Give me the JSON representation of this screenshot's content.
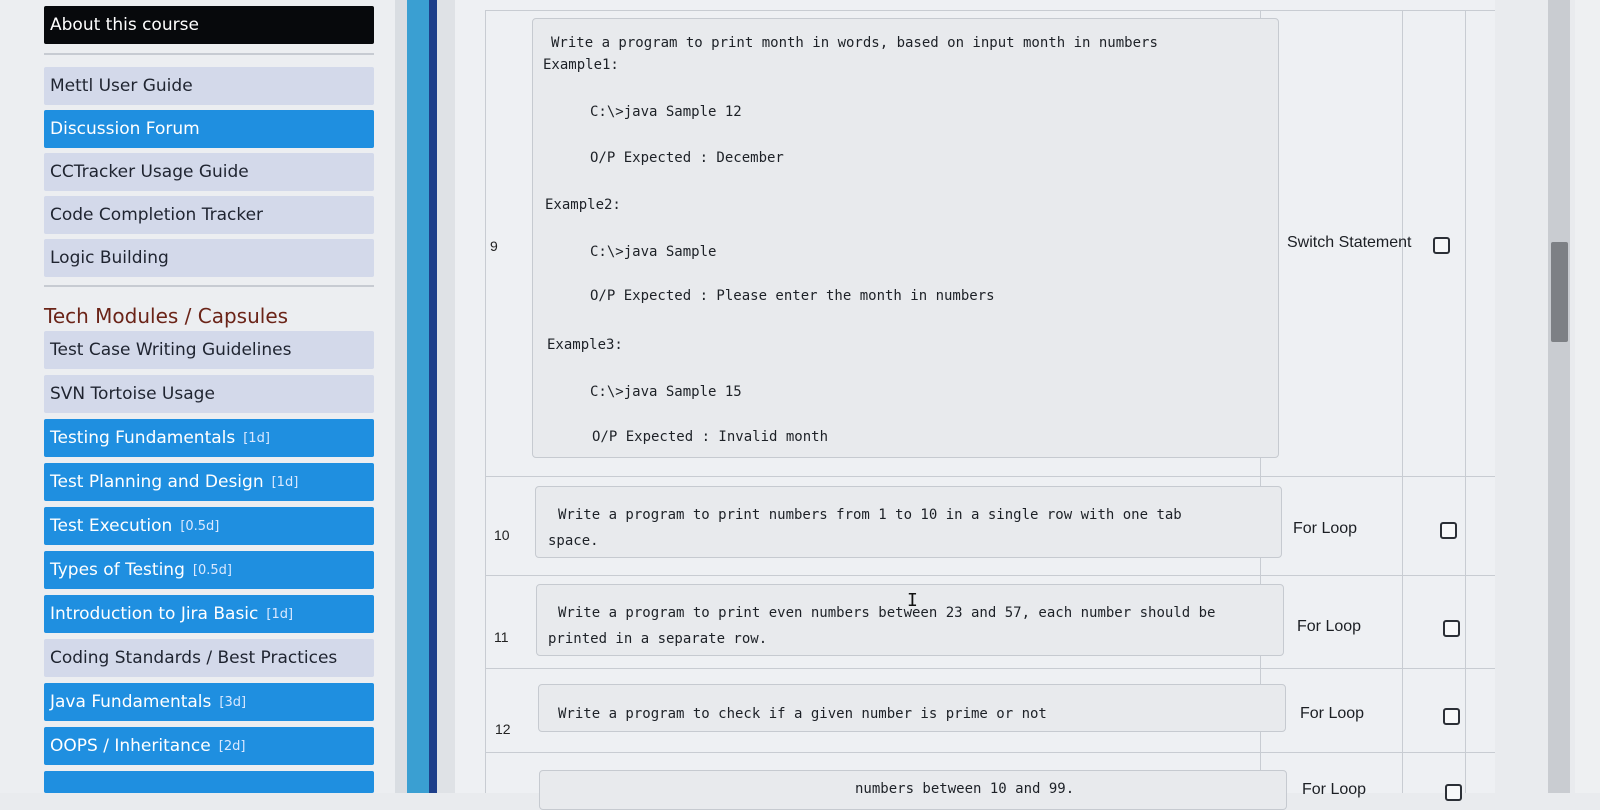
{
  "sidebar": {
    "about": "About this course",
    "items_top": [
      {
        "label": "Mettl User Guide",
        "style": "light"
      },
      {
        "label": "Discussion Forum",
        "style": "blue"
      },
      {
        "label": "CCTracker Usage Guide",
        "style": "light"
      },
      {
        "label": "Code Completion Tracker",
        "style": "light"
      },
      {
        "label": "Logic Building",
        "style": "light"
      }
    ],
    "section_heading": "Tech Modules / Capsules",
    "modules": [
      {
        "label": "Test Case Writing Guidelines",
        "duration": "",
        "style": "light"
      },
      {
        "label": "SVN Tortoise Usage",
        "duration": "",
        "style": "light"
      },
      {
        "label": "Testing Fundamentals",
        "duration": "[1d]",
        "style": "blue"
      },
      {
        "label": "Test Planning and Design",
        "duration": "[1d]",
        "style": "blue"
      },
      {
        "label": "Test Execution",
        "duration": "[0.5d]",
        "style": "blue"
      },
      {
        "label": "Types of Testing",
        "duration": "[0.5d]",
        "style": "blue"
      },
      {
        "label": "Introduction to Jira Basic",
        "duration": "[1d]",
        "style": "blue"
      },
      {
        "label": "Coding Standards / Best Practices",
        "duration": "",
        "style": "light"
      },
      {
        "label": "Java Fundamentals",
        "duration": "[3d]",
        "style": "blue"
      },
      {
        "label": "OOPS / Inheritance",
        "duration": "[2d]",
        "style": "blue"
      }
    ]
  },
  "table": {
    "rows": [
      {
        "num": "9",
        "lines": [
          "Write a program to print month in words, based on input month in numbers",
          "Example1:",
          "C:\\>java Sample 12",
          "O/P Expected : December",
          "Example2:",
          "C:\\>java Sample",
          "O/P Expected : Please enter the month in numbers",
          "Example3:",
          "C:\\>java Sample 15",
          "O/P Expected : Invalid month"
        ],
        "topic": "Switch Statement"
      },
      {
        "num": "10",
        "lines": [
          "Write a program to print numbers from 1 to 10 in a single row with one tab",
          "space."
        ],
        "topic": "For Loop"
      },
      {
        "num": "11",
        "lines": [
          "Write a program to print even numbers between 23 and 57, each number should be",
          "printed in a separate row."
        ],
        "topic": "For Loop"
      },
      {
        "num": "12",
        "lines": [
          "Write a program to check if a given number is prime or not"
        ],
        "topic": "For Loop"
      },
      {
        "num": "",
        "lines": [
          "numbers between 10 and 99."
        ],
        "topic": "For Loop"
      }
    ]
  },
  "colors": {
    "accent_blue": "#1f8fe0",
    "heading_brown": "#6b2418",
    "about_bg": "#07090c"
  }
}
